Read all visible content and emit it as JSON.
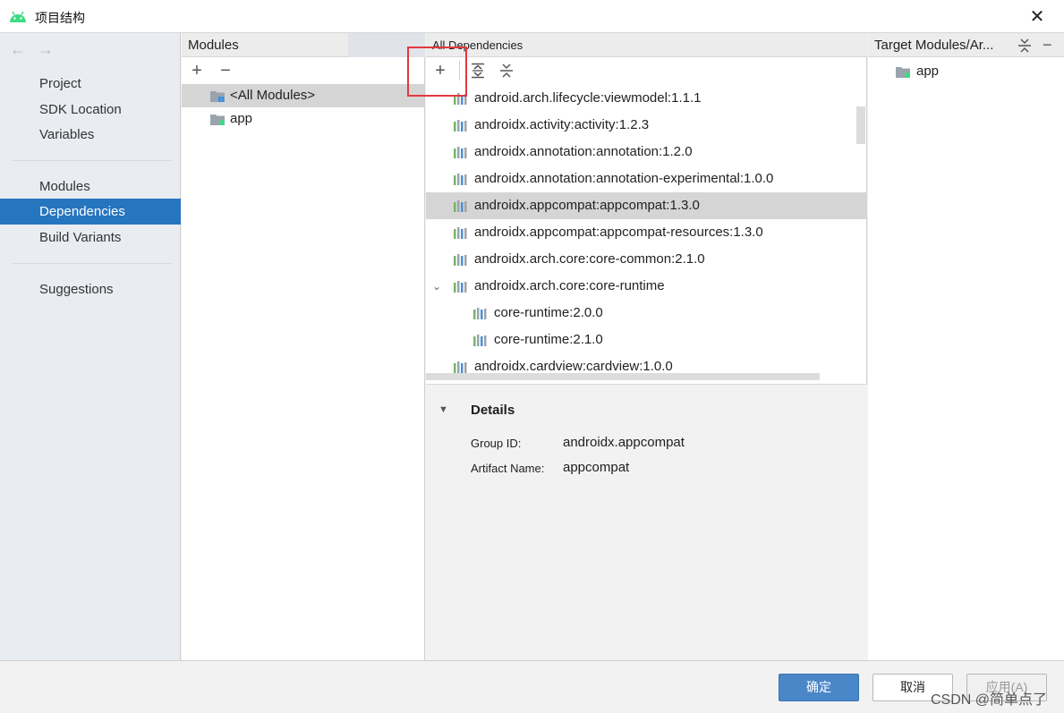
{
  "window": {
    "title": "项目结构",
    "close_icon": "close-icon"
  },
  "sidebar": {
    "back_icon": "arrow-left-icon",
    "forward_icon": "arrow-right-icon",
    "groups": [
      [
        "Project",
        "SDK Location",
        "Variables"
      ],
      [
        "Modules",
        "Dependencies",
        "Build Variants"
      ],
      [
        "Suggestions"
      ]
    ],
    "selected": "Dependencies"
  },
  "modules_panel": {
    "title": "Modules",
    "add_label": "+",
    "remove_label": "−",
    "items": [
      "<All Modules>",
      "app"
    ],
    "selected_index": 0
  },
  "deps_panel": {
    "title": "All Dependencies",
    "add_label": "+",
    "items": [
      "android.arch.lifecycle:viewmodel:1.1.1",
      "androidx.activity:activity:1.2.3",
      "androidx.annotation:annotation:1.2.0",
      "androidx.annotation:annotation-experimental:1.0.0",
      "androidx.appcompat:appcompat:1.3.0",
      "androidx.appcompat:appcompat-resources:1.3.0",
      "androidx.arch.core:core-common:2.1.0",
      "androidx.arch.core:core-runtime",
      "core-runtime:2.0.0",
      "core-runtime:2.1.0",
      "androidx.cardview:cardview:1.0.0"
    ],
    "selected_index": 4,
    "details": {
      "heading": "Details",
      "group_label": "Group ID:",
      "group_value": "androidx.appcompat",
      "artifact_label": "Artifact Name:",
      "artifact_value": "appcompat"
    }
  },
  "target_panel": {
    "title": "Target Modules/Ar...",
    "items": [
      "app"
    ]
  },
  "footer": {
    "ok_label": "确定",
    "cancel_label": "取消",
    "apply_label": "应用(A)"
  },
  "watermark": "CSDN @简单点了",
  "colors": {
    "accent": "#2675bf",
    "selection": "#d5d5d5",
    "highlight": "#e0393e"
  }
}
